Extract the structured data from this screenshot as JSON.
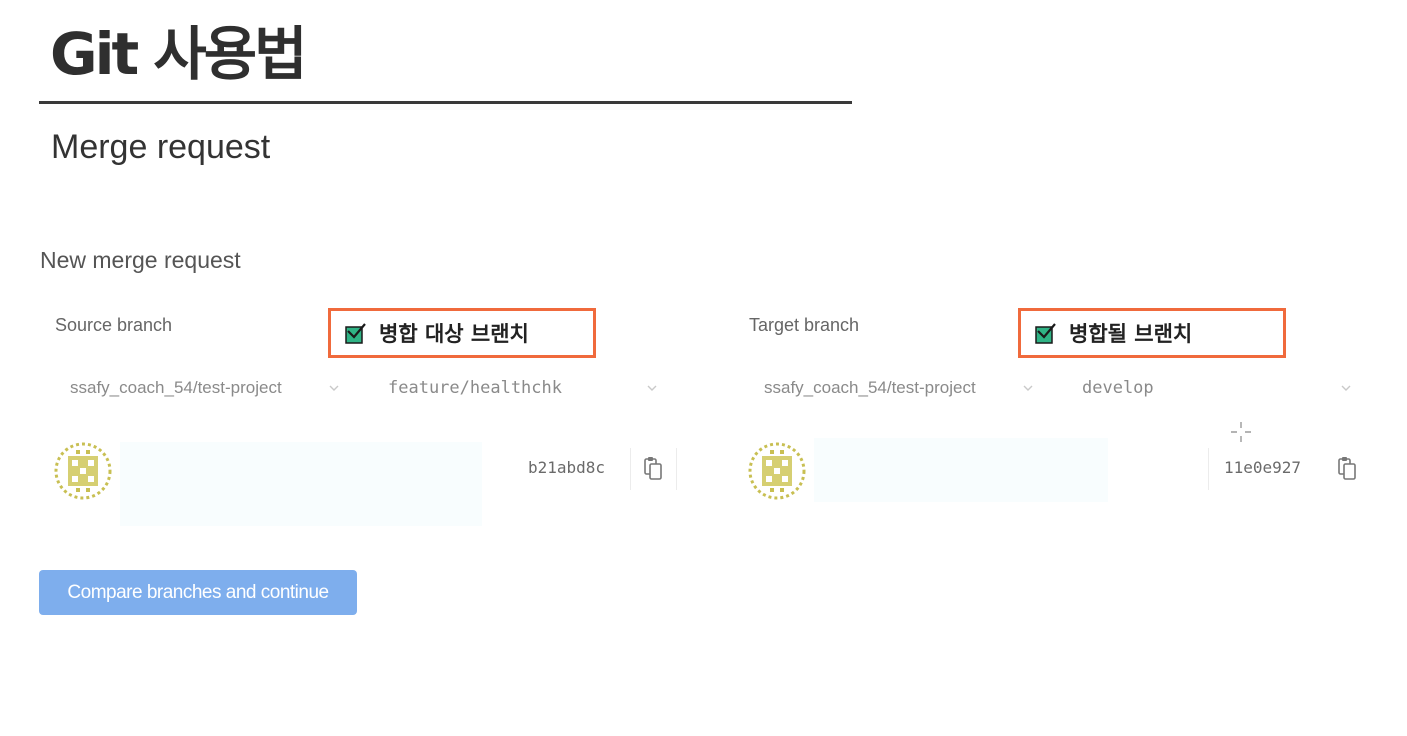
{
  "slide": {
    "title": "Git 사용법",
    "subtitle": "Merge request"
  },
  "form": {
    "title": "New merge request",
    "source": {
      "label": "Source branch",
      "callout": "병합 대상 브랜치",
      "project": "ssafy_coach_54/test-project",
      "branch": "feature/healthchk",
      "commit_sha": "b21abd8c"
    },
    "target": {
      "label": "Target branch",
      "callout": "병합될 브랜치",
      "project": "ssafy_coach_54/test-project",
      "branch": "develop",
      "commit_sha": "11e0e927"
    },
    "submit_label": "Compare branches and continue"
  },
  "icons": {
    "callout_check": "checkbox-icon",
    "select_arrow": "chevron-down-icon",
    "copy": "clipboard-copy-icon",
    "avatar": "identicon-avatar",
    "cursor": "crosshair-cursor-icon"
  },
  "colors": {
    "callout_border": "#f06a3c",
    "check_fill": "#2fb385",
    "button_bg": "#7eaeed",
    "avatar_color": "#c8bf52",
    "title_rule": "#3a3a3a"
  }
}
